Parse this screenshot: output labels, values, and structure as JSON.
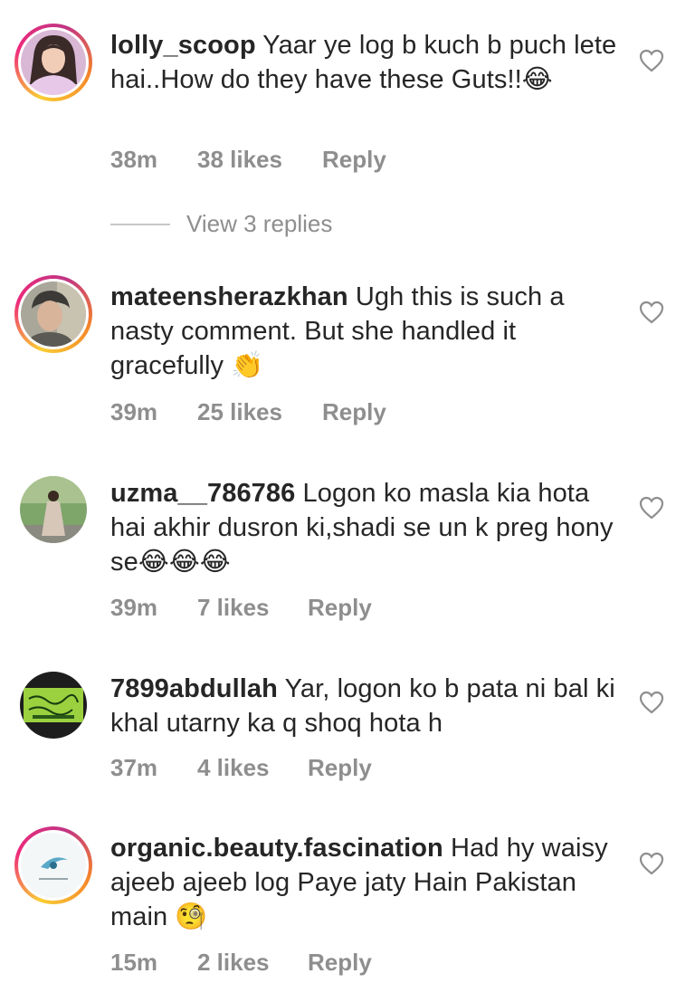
{
  "comments": [
    {
      "username": "lolly_scoop",
      "text": " Yaar ye log b kuch b puch lete hai..How do they have these Guts!!😂",
      "time": "38m",
      "likes": "38 likes",
      "reply": "Reply",
      "story_ring": true,
      "avatar_icon": "woman-portrait-icon"
    },
    {
      "username": "mateensherazkhan",
      "text": " Ugh this is such a nasty comment. But she handled it gracefully 👏",
      "time": "39m",
      "likes": "25 likes",
      "reply": "Reply",
      "story_ring": true,
      "avatar_icon": "man-portrait-icon"
    },
    {
      "username": "uzma__786786",
      "text": " Logon ko masla kia hota hai akhir dusron ki,shadi se un k preg hony se😂😂😂",
      "time": "39m",
      "likes": "7 likes",
      "reply": "Reply",
      "story_ring": false,
      "avatar_icon": "woman-outdoor-icon"
    },
    {
      "username": "7899abdullah",
      "text": " Yar, logon ko b pata ni bal ki khal utarny ka q shoq hota h",
      "time": "37m",
      "likes": "4 likes",
      "reply": "Reply",
      "story_ring": false,
      "avatar_icon": "arabic-calligraphy-icon"
    },
    {
      "username": "organic.beauty.fascination",
      "text": " Had hy waisy ajeeb ajeeb log Paye jaty Hain Pakistan main 🧐",
      "time": "15m",
      "likes": "2 likes",
      "reply": "Reply",
      "story_ring": true,
      "avatar_icon": "brand-logo-icon"
    }
  ],
  "view_replies": "View 3 replies",
  "colors": {
    "text": "#262626",
    "meta": "#8e8e8e",
    "heart": "#8e8e8e"
  }
}
